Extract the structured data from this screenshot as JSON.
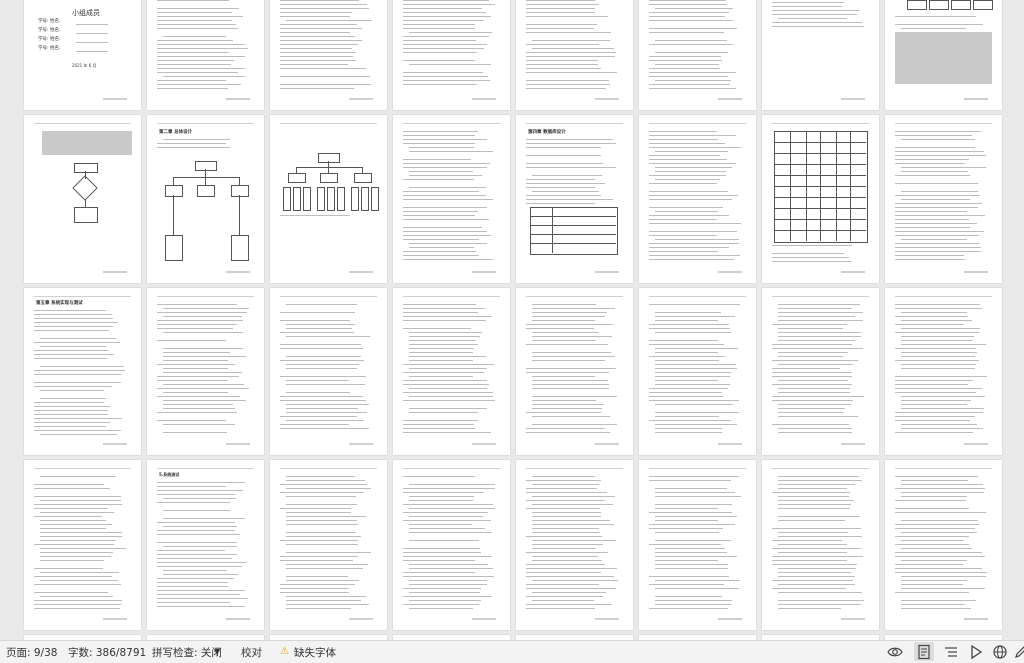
{
  "status_bar": {
    "page_label": "页面: 9/38",
    "word_count_label": "字数: 386/8791",
    "spell_check_label": "拼写检查: 关闭",
    "proofread_label": "校对",
    "missing_font_label": "缺失字体"
  },
  "pages": {
    "p1_title": "小组成员",
    "p1_members": [
      "学号: 姓名:",
      "学号: 姓名:",
      "学号: 姓名:",
      "学号: 姓名:"
    ],
    "p1_date": "2021 年 6 月",
    "p10_chapter": "第二章 总体设计",
    "p13_chapter": "第四章 数据库设计",
    "p17_chapter": "第五章 系统实现与测试",
    "p25_section": "5.系统测试"
  },
  "colors": {
    "background": "#e9e9e9",
    "page": "#ffffff",
    "status_bar": "#f3f3f3",
    "warning": "#e6a100"
  },
  "icons": [
    "caret-down-icon",
    "warning-icon",
    "eye-icon",
    "document-view-icon",
    "outline-icon",
    "play-icon",
    "globe-icon",
    "pen-icon"
  ]
}
